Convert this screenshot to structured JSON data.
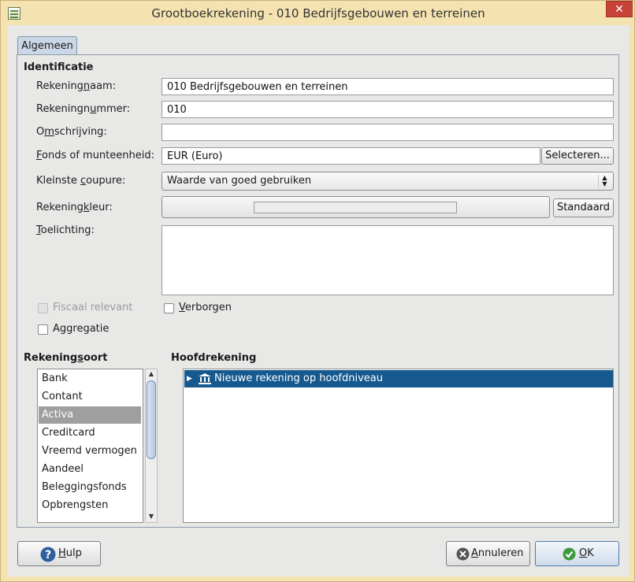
{
  "window": {
    "title": "Grootboekrekening - 010 Bedrijfsgebouwen en terreinen",
    "close_symbol": "✕"
  },
  "tabs": [
    {
      "label": "Algemeen",
      "active": true
    }
  ],
  "identification": {
    "section_title": "Identificatie",
    "fields": {
      "name": {
        "label": "Rekeningnaam:",
        "value": "010 Bedrijfsgebouwen en terreinen"
      },
      "number": {
        "label": "Rekeningnummer:",
        "value": "010"
      },
      "description": {
        "label": "Omschrijving:",
        "value": ""
      },
      "currency": {
        "label": "Fonds of munteenheid:",
        "value": "EUR (Euro)",
        "button": "Selecteren..."
      },
      "smallest_unit": {
        "label": "Kleinste coupure:",
        "value": "Waarde van goed gebruiken"
      },
      "color": {
        "label": "Rekeningkleur:",
        "button": "Standaard"
      },
      "notes": {
        "label": "Toelichting:",
        "value": ""
      }
    },
    "checkboxes": {
      "tax_related": {
        "label": "Fiscaal relevant",
        "checked": false,
        "enabled": false
      },
      "hidden": {
        "label": "Verborgen",
        "checked": false,
        "enabled": true
      },
      "placeholder": {
        "label": "Aggregatie",
        "checked": false,
        "enabled": true
      }
    }
  },
  "account_types": {
    "section_title": "Rekeningsoort",
    "items": [
      "Bank",
      "Contant",
      "Activa",
      "Creditcard",
      "Vreemd vermogen",
      "Aandeel",
      "Beleggingsfonds",
      "Opbrengsten"
    ],
    "selected": "Activa"
  },
  "parent_account": {
    "section_title": "Hoofdrekening",
    "items": [
      {
        "label": "Nieuwe rekening op hoofdniveau",
        "icon": "bank-icon",
        "selected": true
      }
    ]
  },
  "buttons": {
    "help": "Hulp",
    "cancel": "Annuleren",
    "ok": "OK"
  },
  "colors": {
    "selection": "#15598f",
    "list_selection": "#9f9f9f",
    "title_bar": "#f4e3b0",
    "close": "#c7433a"
  }
}
